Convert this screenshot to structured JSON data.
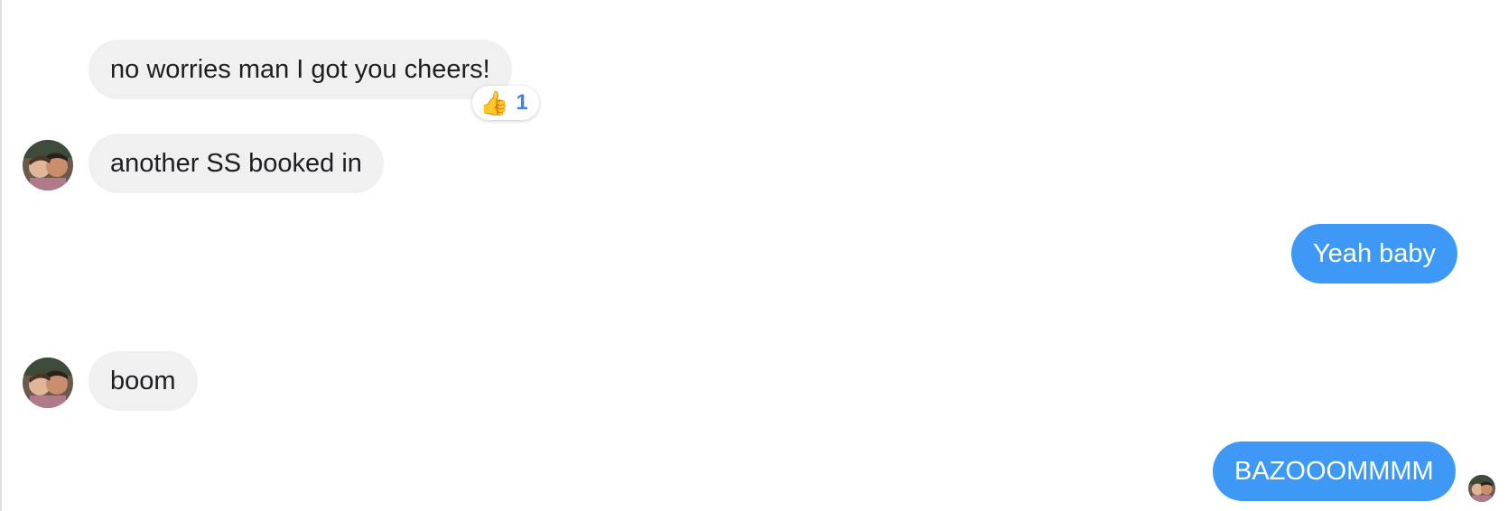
{
  "messages": [
    {
      "text": "no worries man I got you cheers!",
      "direction": "incoming"
    },
    {
      "text": "another SS booked in",
      "direction": "incoming"
    },
    {
      "text": "Yeah baby",
      "direction": "outgoing"
    },
    {
      "text": "boom",
      "direction": "incoming"
    },
    {
      "text": "BAZOOOMMMM",
      "direction": "outgoing"
    }
  ],
  "reaction": {
    "icon": "thumbs-up-icon",
    "emoji": "👍",
    "count": "1"
  },
  "colors": {
    "incoming_bubble": "#f0f0f0",
    "outgoing_bubble": "#3d99f5",
    "reaction_count": "#3b86e6"
  }
}
